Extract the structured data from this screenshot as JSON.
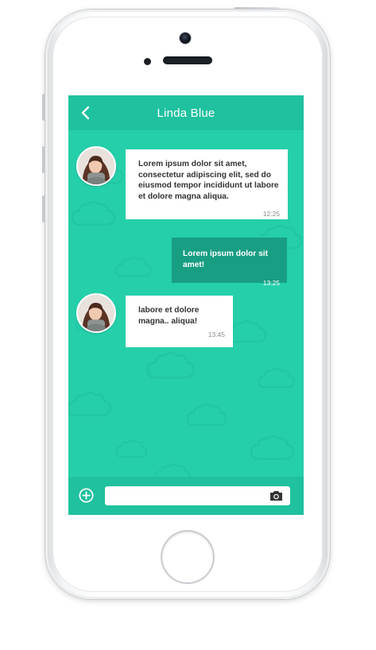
{
  "header": {
    "title": "Linda Blue",
    "back_icon": "chevron-left-icon"
  },
  "colors": {
    "screen_bg": "#25cfaa",
    "header_bg": "#1fc19e",
    "outgoing_bubble": "#189e83",
    "incoming_bubble": "#ffffff"
  },
  "messages": [
    {
      "direction": "incoming",
      "text": "Lorem ipsum dolor sit amet, consectetur adipiscing elit, sed do eiusmod tempor incididunt ut labore et dolore magna aliqua.",
      "time": "12:25"
    },
    {
      "direction": "outgoing",
      "text": "Lorem ipsum dolor sit amet!",
      "time": "13:25"
    },
    {
      "direction": "incoming",
      "text": "labore et dolore magna.. aliqua!",
      "time": "13:45"
    }
  ],
  "composer": {
    "value": "",
    "placeholder": "",
    "add_icon": "plus-circle-icon",
    "camera_icon": "camera-icon"
  }
}
